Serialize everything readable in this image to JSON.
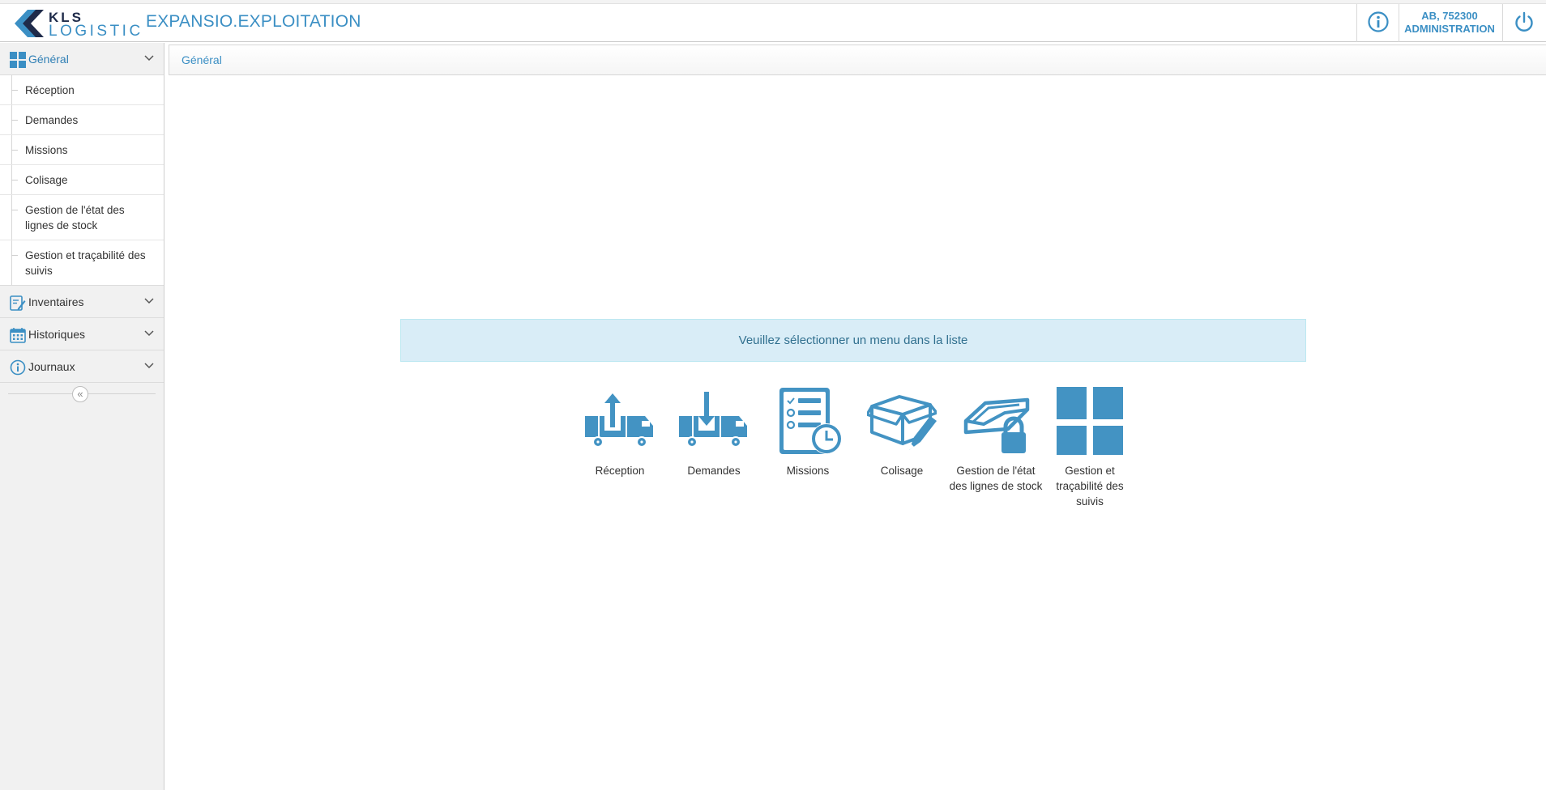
{
  "header": {
    "logo_top": "KLS",
    "logo_bottom": "LOGISTIC",
    "app_title": "EXPANSIO.EXPLOITATION",
    "user_line1": "AB, 752300",
    "user_line2": "ADMINISTRATION",
    "accent_color": "#3b8fc4"
  },
  "sidebar": {
    "sections": [
      {
        "label": "Général",
        "icon": "grid-icon",
        "expanded": true
      },
      {
        "label": "Inventaires",
        "icon": "inventory-edit-icon",
        "expanded": false
      },
      {
        "label": "Historiques",
        "icon": "calendar-icon",
        "expanded": false
      },
      {
        "label": "Journaux",
        "icon": "info-icon",
        "expanded": false
      }
    ],
    "general_items": [
      "Réception",
      "Demandes",
      "Missions",
      "Colisage",
      "Gestion de l'état des lignes de stock",
      "Gestion et traçabilité des suivis"
    ],
    "collapse_icon": "double-chevron-left-icon"
  },
  "breadcrumb": {
    "current": "Général"
  },
  "main": {
    "message": "Veuillez sélectionner un menu dans la liste",
    "tiles": [
      {
        "label": "Réception",
        "icon": "truck-upload-icon"
      },
      {
        "label": "Demandes",
        "icon": "truck-download-icon"
      },
      {
        "label": "Missions",
        "icon": "checklist-clock-icon"
      },
      {
        "label": "Colisage",
        "icon": "box-pencil-icon"
      },
      {
        "label": "Gestion de l'état des lignes de stock",
        "icon": "tray-lock-icon"
      },
      {
        "label": "Gestion et traçabilité des suivis",
        "icon": "grid-icon"
      }
    ]
  }
}
